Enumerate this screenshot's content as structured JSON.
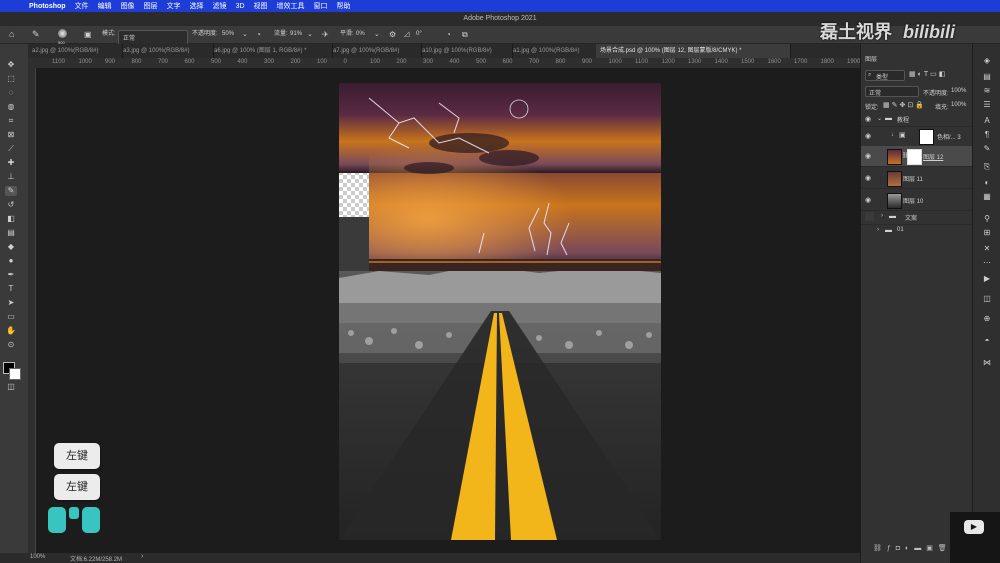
{
  "menubar": {
    "app": "Photoshop",
    "items": [
      "文件",
      "编辑",
      "图像",
      "图层",
      "文字",
      "选择",
      "滤镜",
      "3D",
      "视图",
      "增效工具",
      "窗口",
      "帮助"
    ]
  },
  "window_title": "Adobe Photoshop 2021",
  "options": {
    "mode_label": "模式:",
    "mode_value": "正常",
    "opacity_label": "不透明度:",
    "opacity_value": "50%",
    "flow_label": "流量:",
    "flow_value": "91%",
    "smooth_label": "平滑:",
    "smooth_value": "0%",
    "angle_value": "0°",
    "brush_size": "500"
  },
  "tabs": [
    "a2.jpg @ 100%(RGB/8#)",
    "a3.jpg @ 100%(RGB/8#)",
    "a6.jpg @ 100% (图层 1, RGB/8#) *",
    "a7.jpg @ 100%(RGB/8#)",
    "a10.jpg @ 100%(RGB/8#)",
    "a1.jpg @ 100%(RGB/8#)",
    "场景合成.psd @ 100% (图层 12, 图层蒙版/8/CMYK) *"
  ],
  "ruler_ticks": [
    "1100",
    "1000",
    "900",
    "800",
    "700",
    "600",
    "500",
    "400",
    "300",
    "200",
    "100",
    "0",
    "100",
    "200",
    "300",
    "400",
    "500",
    "600",
    "700",
    "800",
    "900",
    "1000",
    "1100",
    "1200",
    "1300",
    "1400",
    "1500",
    "1600",
    "1700",
    "1800",
    "1900"
  ],
  "status": {
    "zoom": "100%",
    "doc": "文档:6.22M/258.2M"
  },
  "layers_panel": {
    "title": "图层",
    "filter_label": "类型",
    "blend_mode": "正常",
    "opacity_label": "不透明度:",
    "opacity_value": "100%",
    "lock_label": "锁定:",
    "fill_label": "填充:",
    "fill_value": "100%",
    "layers": [
      {
        "name": "教程",
        "kind": "group"
      },
      {
        "name": "色相/... 3",
        "kind": "adjustment"
      },
      {
        "name": "图层 12",
        "kind": "layer-mask",
        "active": true
      },
      {
        "name": "图层 11",
        "kind": "layer"
      },
      {
        "name": "图层 10",
        "kind": "layer"
      },
      {
        "name": "文案",
        "kind": "group"
      },
      {
        "name": "01",
        "kind": "group"
      }
    ]
  },
  "overlay": {
    "key_top": "左键",
    "key_bottom": "左键",
    "watermark": "磊土视界",
    "watermark_logo": "bilibili"
  },
  "colors": {
    "menubar": "#1d3dd6",
    "road_line": "#f2b61a",
    "sky_orange": "#c8741c",
    "sky_purple": "#5a2a44"
  }
}
